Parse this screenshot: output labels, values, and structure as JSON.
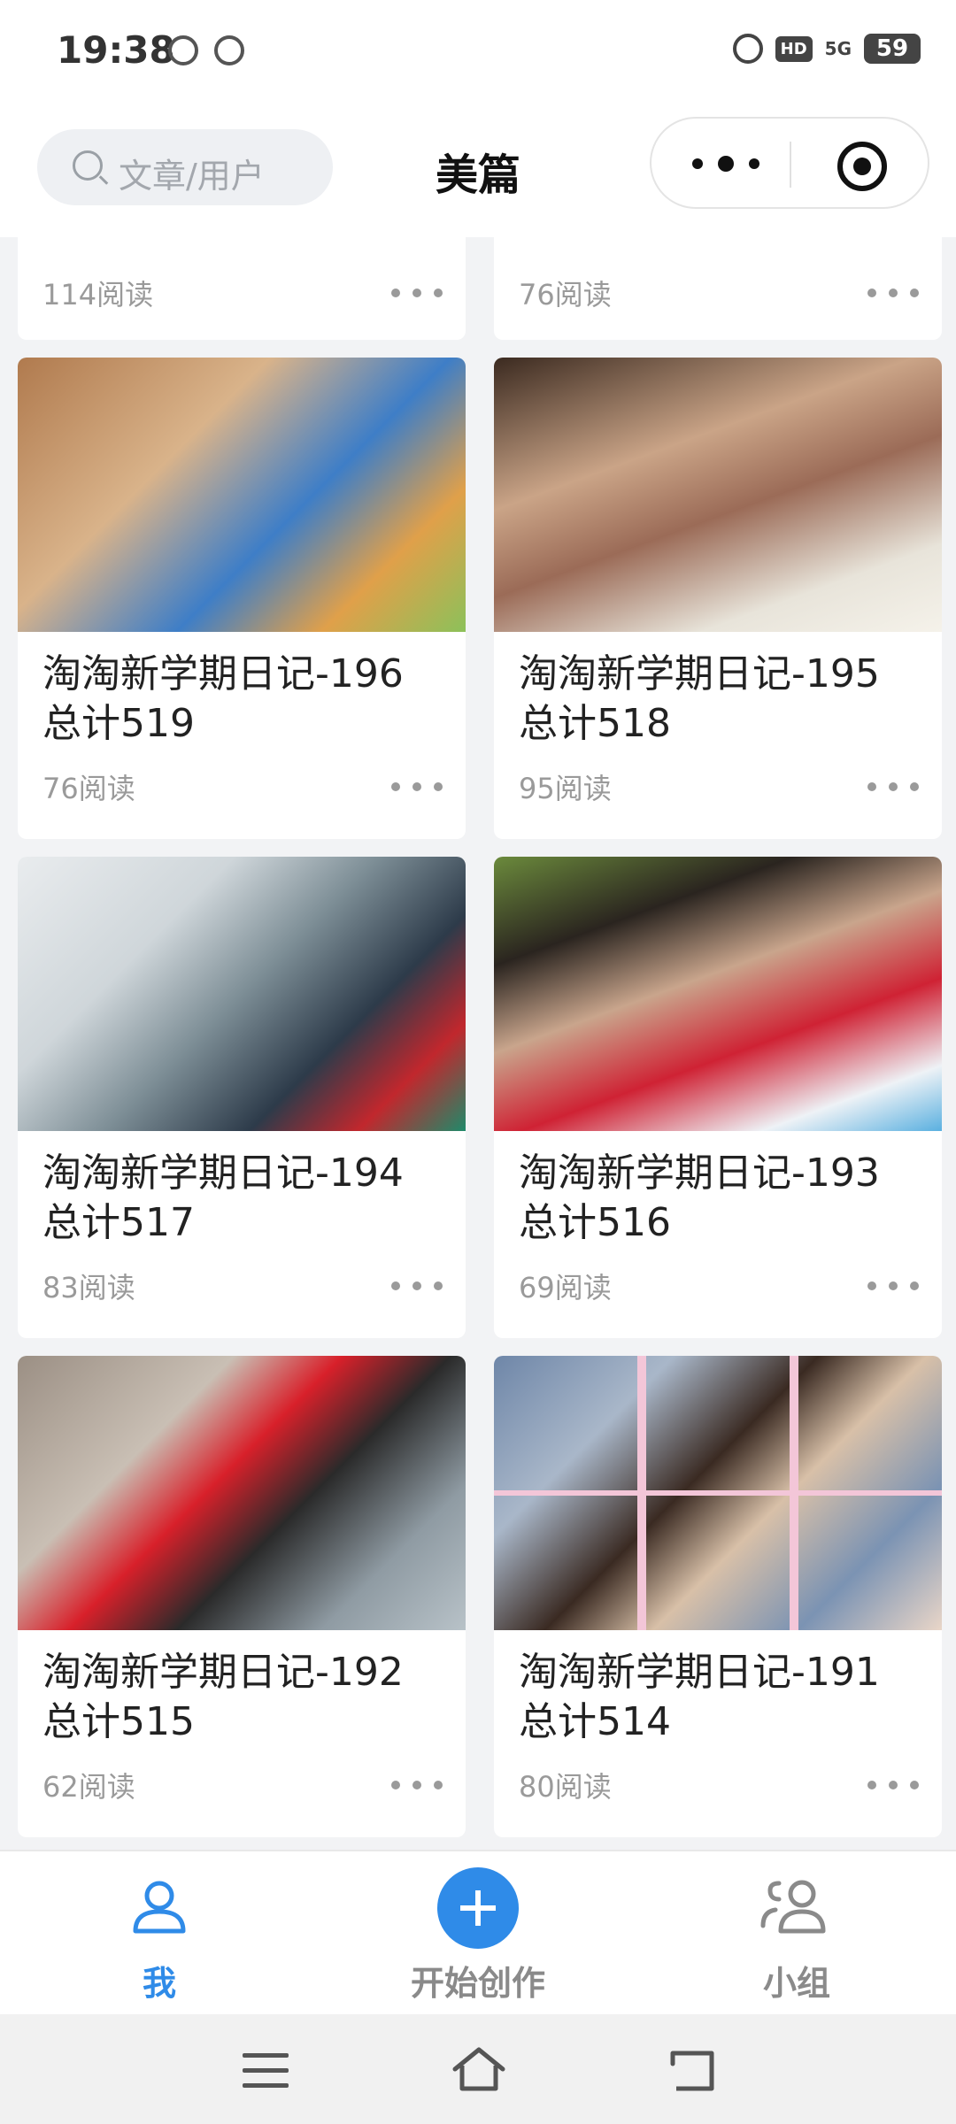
{
  "status_bar": {
    "time": "19:38",
    "network": "5G",
    "hd_badge": "HD",
    "battery": "59",
    "icons": [
      "wechat-icon",
      "app-icon",
      "alarm-icon",
      "hd-icon",
      "signal-icon",
      "battery-icon"
    ]
  },
  "header": {
    "search_placeholder": "文章/用户",
    "title": "美篇"
  },
  "partial_row": [
    {
      "reads": "114阅读"
    },
    {
      "reads": "76阅读"
    }
  ],
  "cards": [
    {
      "title": "淘淘新学期日记-196 总计519",
      "reads": "76阅读"
    },
    {
      "title": "淘淘新学期日记-195 总计518",
      "reads": "95阅读"
    },
    {
      "title": "淘淘新学期日记-194 总计517",
      "reads": "83阅读"
    },
    {
      "title": "淘淘新学期日记-193 总计516",
      "reads": "69阅读"
    },
    {
      "title": "淘淘新学期日记-192 总计515",
      "reads": "62阅读"
    },
    {
      "title": "淘淘新学期日记-191 总计514",
      "reads": "80阅读"
    }
  ],
  "tabbar": {
    "me": "我",
    "create": "开始创作",
    "group": "小组"
  },
  "colors": {
    "accent": "#2f8be8",
    "muted": "#9a9a9a",
    "background": "#f2f3f5"
  }
}
